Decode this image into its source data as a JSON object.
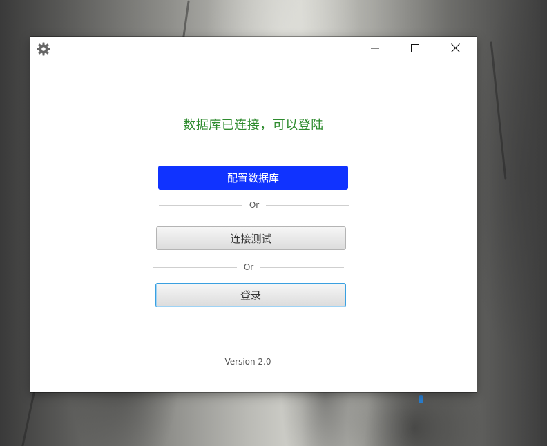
{
  "window": {
    "controls": {
      "minimize_icon": "minimize-icon",
      "maximize_icon": "maximize-icon",
      "close_icon": "close-icon"
    },
    "settings_icon": "gear-icon"
  },
  "main": {
    "status_message": "数据库已连接，可以登陆",
    "status_color": "#2e8b2e",
    "configure_button_label": "配置数据库",
    "configure_button_color": "#1033ff",
    "separator_1": "Or",
    "test_button_label": "连接测试",
    "separator_2": "Or",
    "login_button_label": "登录",
    "version": "Version 2.0"
  }
}
